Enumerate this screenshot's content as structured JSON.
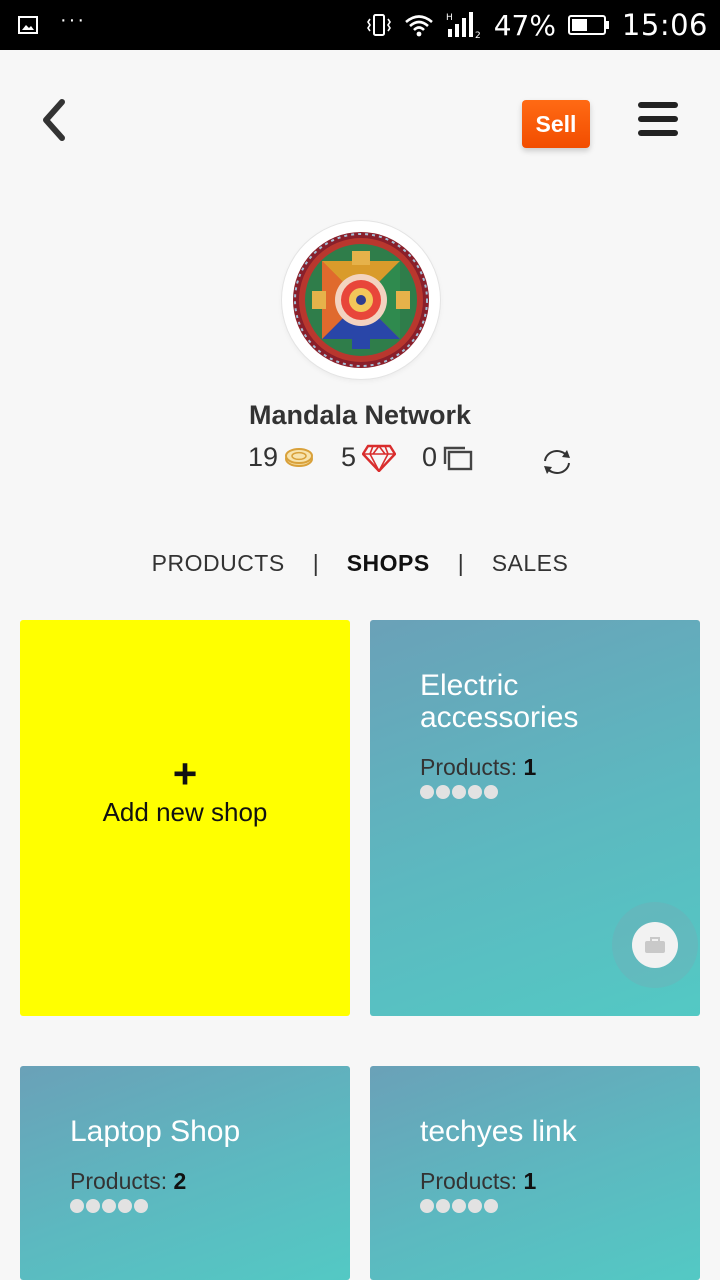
{
  "status_bar": {
    "battery": "47%",
    "time": "15:06",
    "icons": [
      "image-icon",
      "more-dots-icon",
      "vibrate-icon",
      "wifi-icon",
      "signal-icon",
      "battery-icon"
    ],
    "overflow": "···"
  },
  "header": {
    "back_icon": "chevron-left-icon",
    "sell_label": "Sell",
    "menu_icon": "hamburger-menu-icon",
    "sell_color": "#f85a07"
  },
  "profile": {
    "name": "Mandala Network",
    "avatar_icon": "mandala-avatar",
    "coins": "19",
    "gems": "5",
    "cards": "0",
    "refresh_icon": "refresh-icon"
  },
  "tabs": {
    "items": [
      {
        "label": "PRODUCTS",
        "active": false
      },
      {
        "label": "SHOPS",
        "active": true
      },
      {
        "label": "SALES",
        "active": false
      }
    ],
    "separator": "|"
  },
  "add_card": {
    "plus": "+",
    "label": "Add new shop",
    "color": "#ffff00"
  },
  "shops": [
    {
      "name": "Electric accessories",
      "products_label": "Products:",
      "products_count": "1",
      "rating": 0
    },
    {
      "name": "Laptop Shop",
      "products_label": "Products:",
      "products_count": "2",
      "rating": 0
    },
    {
      "name": "techyes link",
      "products_label": "Products:",
      "products_count": "1",
      "rating": 0
    }
  ]
}
